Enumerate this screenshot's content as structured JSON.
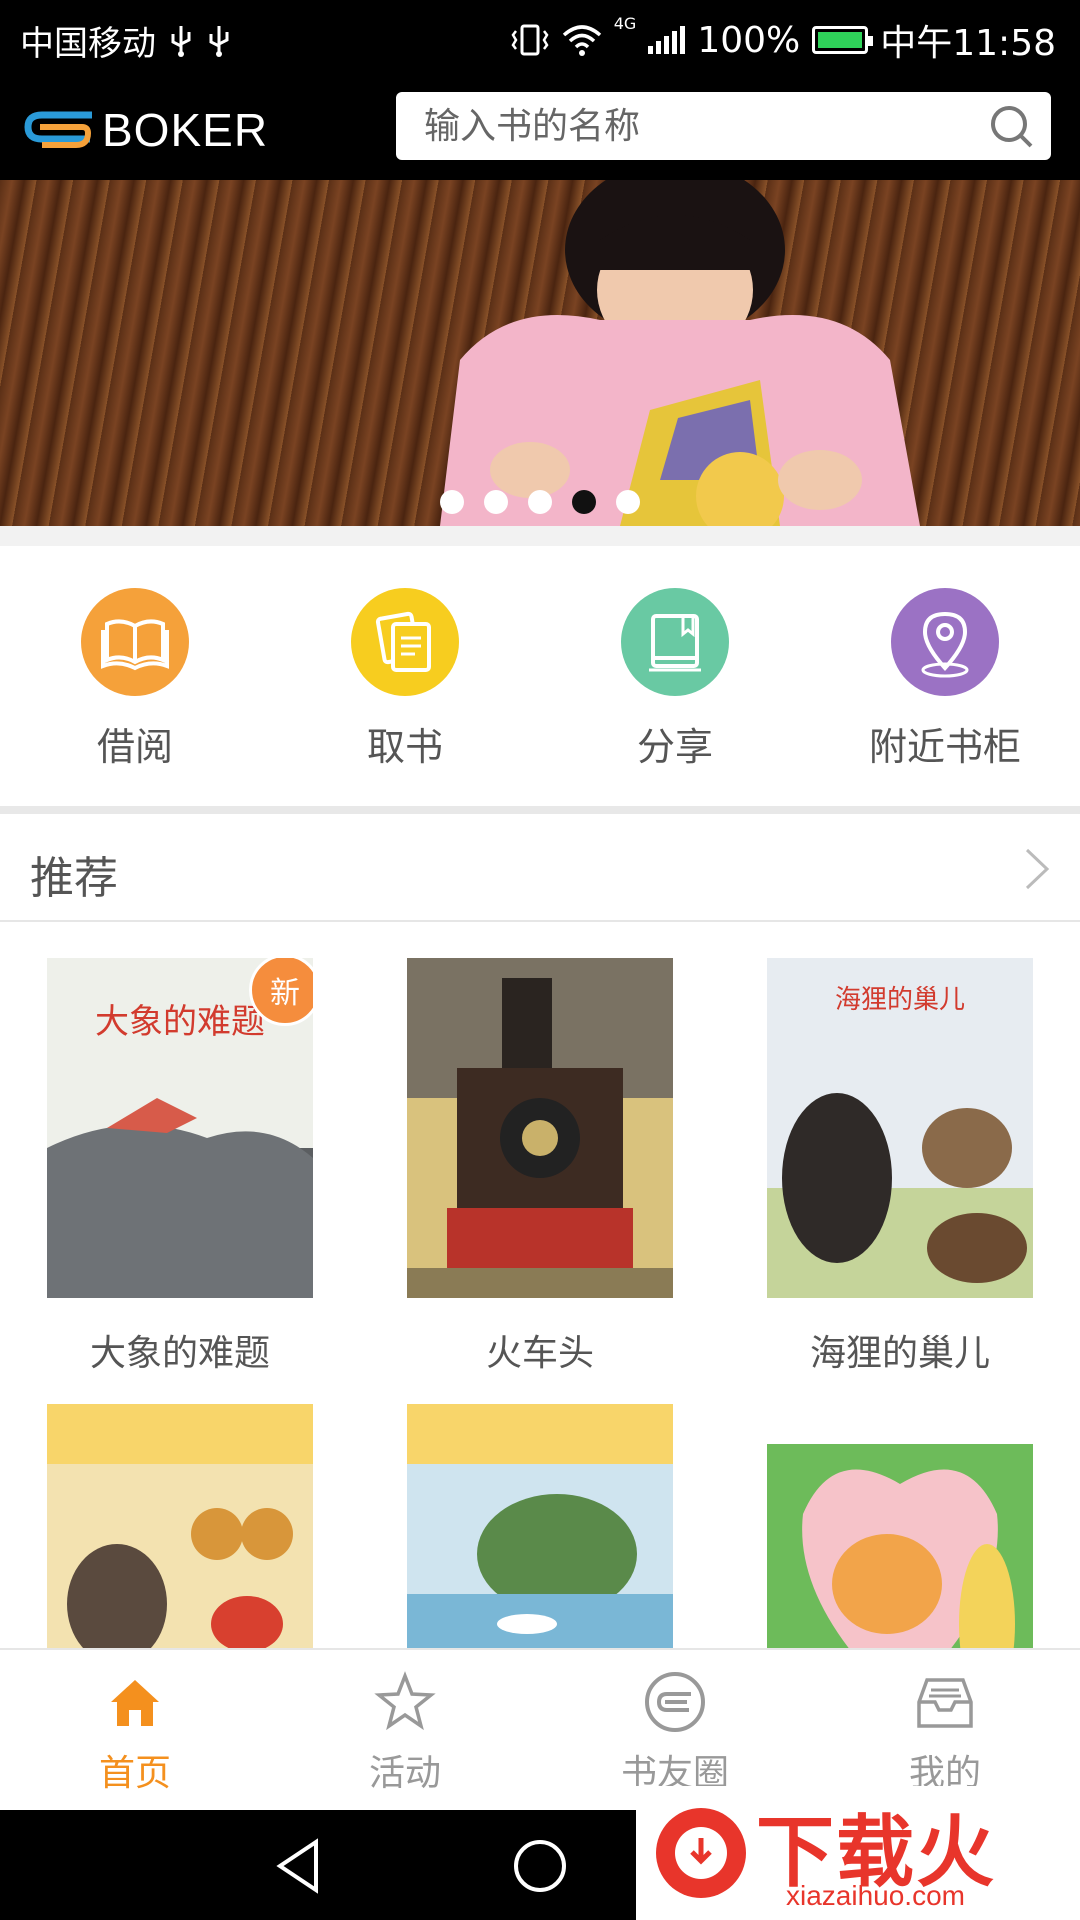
{
  "status_bar": {
    "carrier": "中国移动",
    "usb_icons": [
      "usb-icon",
      "usb-icon"
    ],
    "network": "4G",
    "battery": "100%",
    "time": "中午11:58"
  },
  "header": {
    "logo_text": "BOKER",
    "search_placeholder": "输入书的名称"
  },
  "banner": {
    "slide_count": 5,
    "active_index": 3
  },
  "shortcuts": [
    {
      "label": "借阅",
      "icon": "open-book-icon",
      "color": "#f5a13a"
    },
    {
      "label": "取书",
      "icon": "documents-icon",
      "color": "#f7cd1f"
    },
    {
      "label": "分享",
      "icon": "book-share-icon",
      "color": "#69c9a3"
    },
    {
      "label": "附近书柜",
      "icon": "location-pin-icon",
      "color": "#9b72c4"
    }
  ],
  "recommend": {
    "title": "推荐",
    "books": [
      {
        "title": "大象的难题",
        "badge": "新"
      },
      {
        "title": "火车头",
        "badge": ""
      },
      {
        "title": "海狸的巢儿",
        "badge": ""
      },
      {
        "title": "",
        "badge": ""
      },
      {
        "title": "",
        "badge": ""
      },
      {
        "title": "",
        "badge": ""
      }
    ]
  },
  "tabs": [
    {
      "label": "首页",
      "icon": "home-icon",
      "active": true
    },
    {
      "label": "活动",
      "icon": "star-icon",
      "active": false
    },
    {
      "label": "书友圈",
      "icon": "circle-logo-icon",
      "active": false
    },
    {
      "label": "我的",
      "icon": "inbox-icon",
      "active": false
    }
  ],
  "colors": {
    "accent": "#f4901e",
    "inactive": "#999999"
  },
  "watermark": {
    "text": "下载火",
    "url": "xiazaihuo.com"
  }
}
